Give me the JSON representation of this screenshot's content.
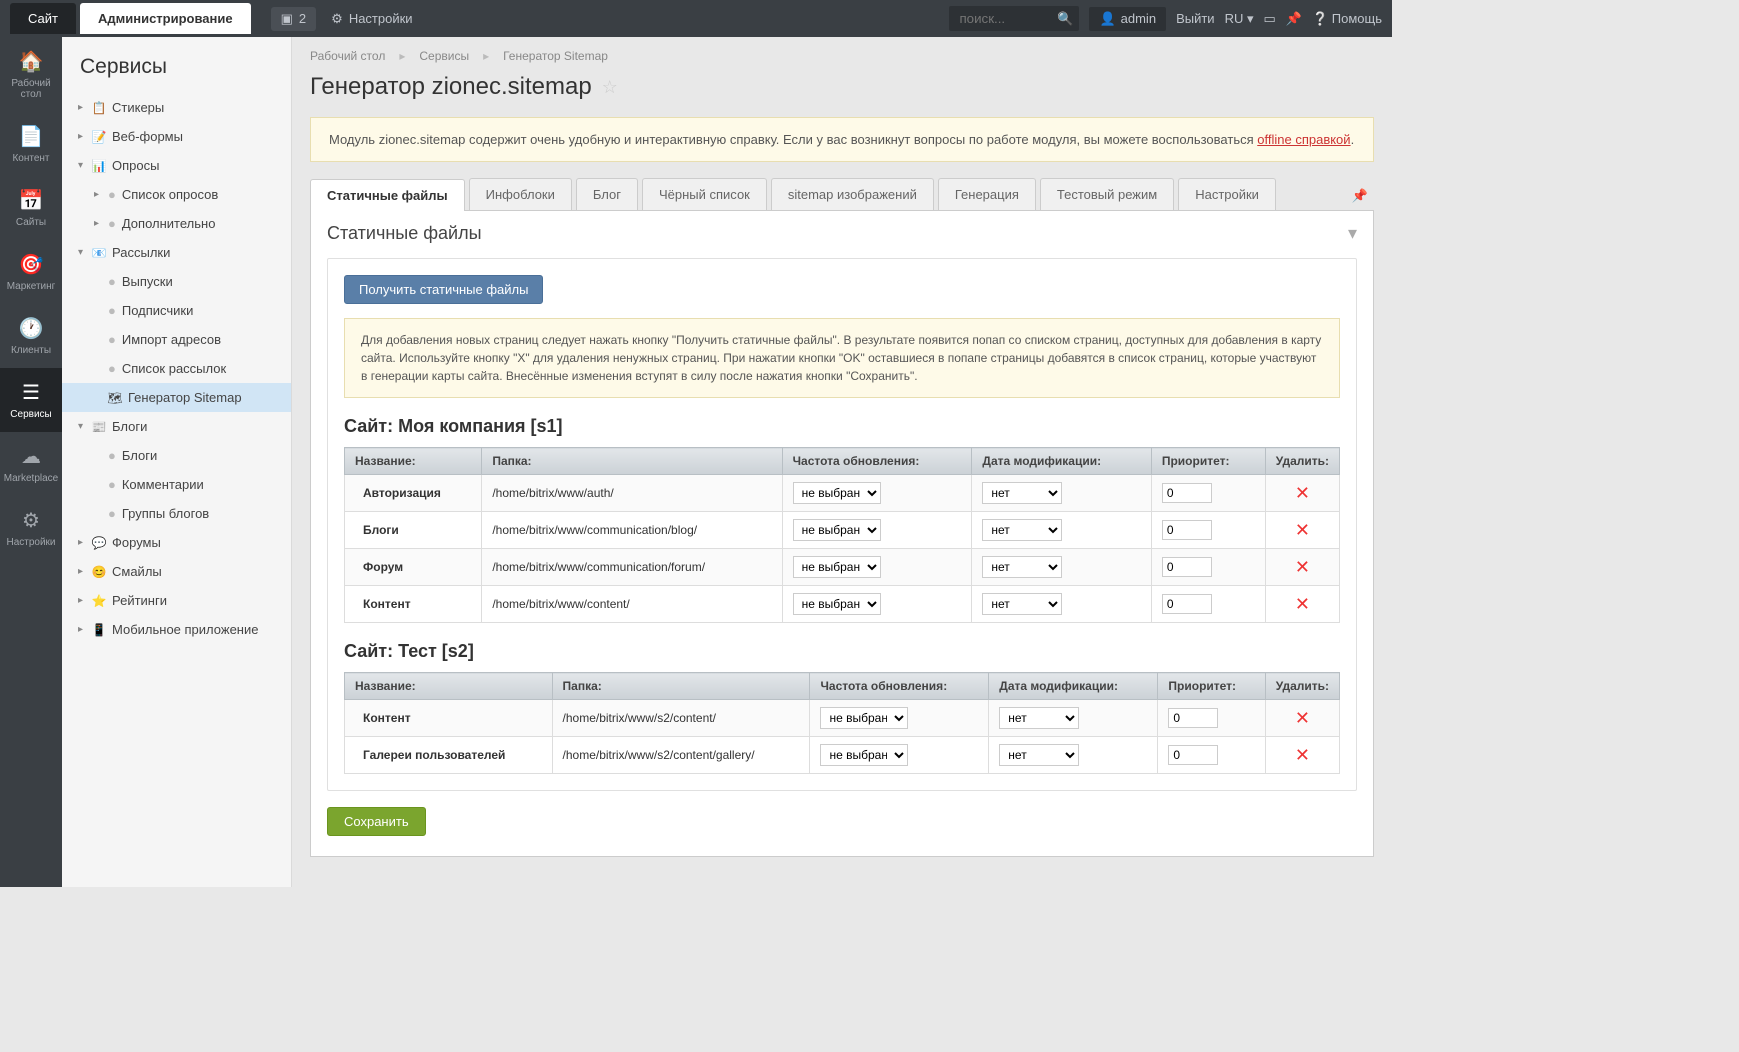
{
  "topbar": {
    "site_tab": "Сайт",
    "admin_tab": "Администрирование",
    "badge_count": "2",
    "settings": "Настройки",
    "search_placeholder": "поиск...",
    "user": "admin",
    "logout": "Выйти",
    "lang": "RU",
    "help": "Помощь"
  },
  "rail": [
    {
      "label": "Рабочий стол"
    },
    {
      "label": "Контент"
    },
    {
      "label": "Сайты"
    },
    {
      "label": "Маркетинг"
    },
    {
      "label": "Клиенты"
    },
    {
      "label": "Сервисы"
    },
    {
      "label": "Marketplace"
    },
    {
      "label": "Настройки"
    }
  ],
  "sidebar": {
    "title": "Сервисы",
    "items": {
      "stickers": "Стикеры",
      "webforms": "Веб-формы",
      "polls": "Опросы",
      "poll_list": "Список опросов",
      "poll_more": "Дополнительно",
      "mail": "Рассылки",
      "mail_issues": "Выпуски",
      "mail_subs": "Подписчики",
      "mail_import": "Импорт адресов",
      "mail_list": "Список рассылок",
      "sitemap_gen": "Генератор Sitemap",
      "blogs": "Блоги",
      "blogs_blogs": "Блоги",
      "blogs_comments": "Комментарии",
      "blogs_groups": "Группы блогов",
      "forums": "Форумы",
      "smiles": "Смайлы",
      "ratings": "Рейтинги",
      "mobile": "Мобильное приложение"
    }
  },
  "crumbs": {
    "c1": "Рабочий стол",
    "c2": "Сервисы",
    "c3": "Генератор Sitemap"
  },
  "page_title": "Генератор zionec.sitemap",
  "notice": {
    "text": "Модуль zionec.sitemap содержит очень удобную и интерактивную справку. Если у вас возникнут вопросы по работе модуля, вы можете воспользоваться ",
    "link": "offline справкой"
  },
  "tabs": [
    "Статичные файлы",
    "Инфоблоки",
    "Блог",
    "Чёрный список",
    "sitemap изображений",
    "Генерация",
    "Тестовый режим",
    "Настройки"
  ],
  "panel_title": "Статичные файлы",
  "get_files_btn": "Получить статичные файлы",
  "info_text": "Для добавления новых страниц следует нажать кнопку \"Получить статичные файлы\". В результате появится попап со списком страниц, доступных для добавления в карту сайта. Используйте кнопку \"X\" для удаления ненужных страниц. При нажатии кнопки \"OK\" оставшиеся в попапе страницы добавятся в список страниц, которые участвуют в генерации карты сайта. Внесённые изменения вступят в силу после нажатия кнопки \"Сохранить\".",
  "headers": {
    "name": "Название:",
    "folder": "Папка:",
    "freq": "Частота обновления:",
    "mod": "Дата модификации:",
    "prio": "Приоритет:",
    "del": "Удалить:"
  },
  "sel_default": "не выбрано",
  "sel_net": "нет",
  "site1_title": "Сайт: Моя компания [s1]",
  "site1_rows": [
    {
      "name": "Авторизация",
      "folder": "/home/bitrix/www/auth/",
      "prio": "0"
    },
    {
      "name": "Блоги",
      "folder": "/home/bitrix/www/communication/blog/",
      "prio": "0"
    },
    {
      "name": "Форум",
      "folder": "/home/bitrix/www/communication/forum/",
      "prio": "0"
    },
    {
      "name": "Контент",
      "folder": "/home/bitrix/www/content/",
      "prio": "0"
    }
  ],
  "site2_title": "Сайт: Тест [s2]",
  "site2_rows": [
    {
      "name": "Контент",
      "folder": "/home/bitrix/www/s2/content/",
      "prio": "0"
    },
    {
      "name": "Галереи пользователей",
      "folder": "/home/bitrix/www/s2/content/gallery/",
      "prio": "0"
    }
  ],
  "save_btn": "Сохранить"
}
